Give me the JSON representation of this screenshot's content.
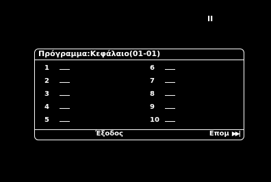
{
  "status": {
    "indicator_icon": "pause-icon",
    "indicator_glyph": "II"
  },
  "program": {
    "title": "Πρόγραμμα:Κεφάλαιο(01-01)",
    "slots_left": [
      {
        "number": "1",
        "value": "__"
      },
      {
        "number": "2",
        "value": "__"
      },
      {
        "number": "3",
        "value": "__"
      },
      {
        "number": "4",
        "value": "__"
      },
      {
        "number": "5",
        "value": "__"
      }
    ],
    "slots_right": [
      {
        "number": "6",
        "value": "__"
      },
      {
        "number": "7",
        "value": "__"
      },
      {
        "number": "8",
        "value": "__"
      },
      {
        "number": "9",
        "value": "__"
      },
      {
        "number": "10",
        "value": "__"
      }
    ],
    "exit_label": "Έξοδος",
    "next_label": "Επομ",
    "next_icon": "skip-forward-icon"
  },
  "colors": {
    "background": "#000000",
    "foreground": "#ffffff"
  }
}
